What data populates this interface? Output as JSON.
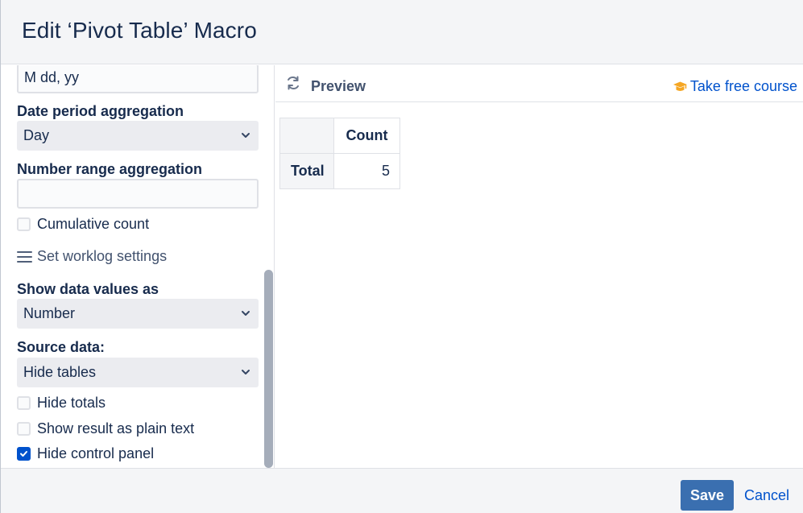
{
  "dialog": {
    "title": "Edit ‘Pivot Table’ Macro"
  },
  "sidebar": {
    "date_format_value": "M dd, yy",
    "date_period": {
      "label": "Date period aggregation",
      "selected": "Day"
    },
    "number_range": {
      "label": "Number range aggregation",
      "value": ""
    },
    "cumulative_count": {
      "label": "Cumulative count",
      "checked": false
    },
    "worklog_link": "Set worklog settings",
    "show_values": {
      "label": "Show data values as",
      "selected": "Number"
    },
    "source_data": {
      "label": "Source data:",
      "selected": "Hide tables"
    },
    "hide_totals": {
      "label": "Hide totals",
      "checked": false
    },
    "plain_text": {
      "label": "Show result as plain text",
      "checked": false
    },
    "hide_control_panel": {
      "label": "Hide control panel",
      "checked": true
    }
  },
  "preview": {
    "title": "Preview",
    "course_link": "Take free course",
    "table": {
      "column_header": "Count",
      "row_header": "Total",
      "value": "5"
    }
  },
  "footer": {
    "save_label": "Save",
    "cancel_label": "Cancel"
  },
  "colors": {
    "primary": "#0052cc",
    "save_button": "#3a6fb0",
    "course_icon": "#f5a623"
  }
}
